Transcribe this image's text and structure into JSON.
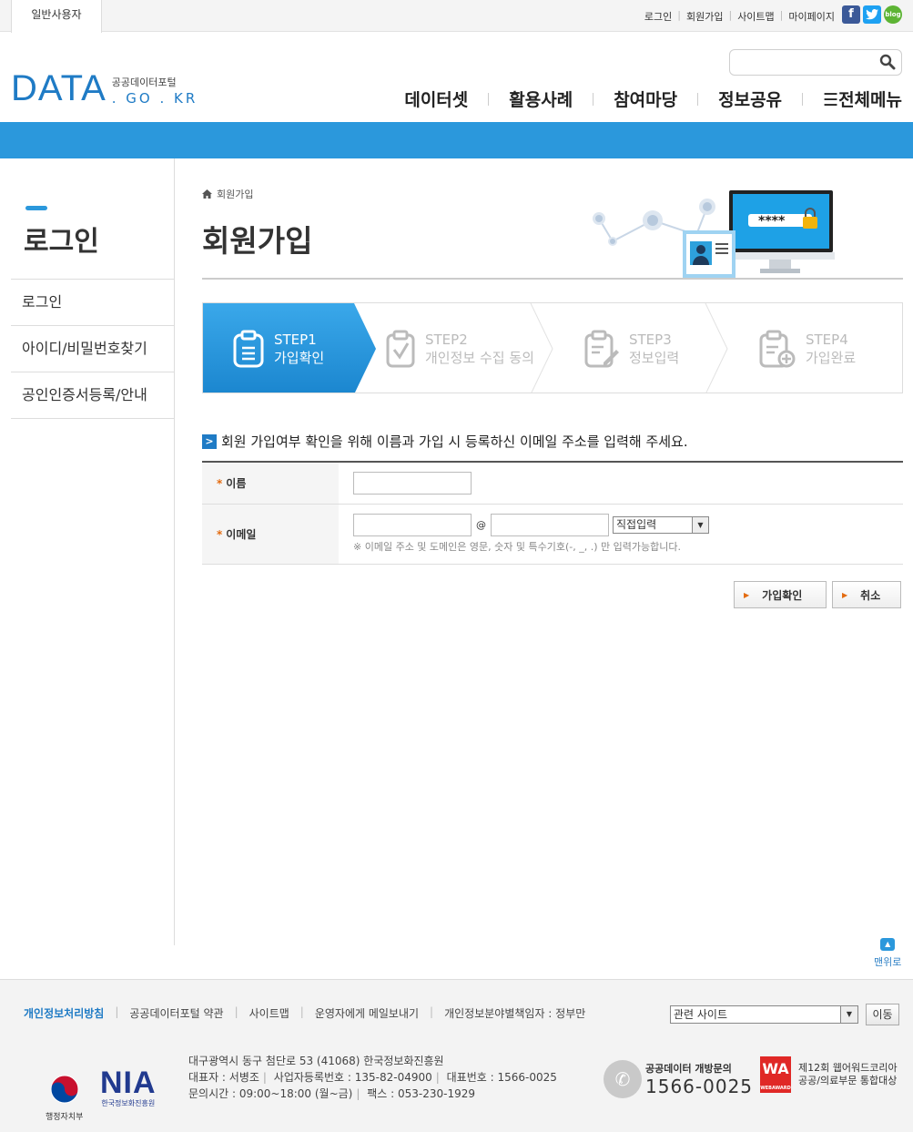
{
  "utility": {
    "user_tab": "일반사용자",
    "links": [
      "로그인",
      "회원가입",
      "사이트맵",
      "마이페이지"
    ],
    "social": {
      "facebook": "f",
      "twitter": "t",
      "blog": "blog"
    }
  },
  "header": {
    "logo_main": "DATA",
    "logo_korean": "공공데이터포털",
    "logo_domain": ". GO . KR",
    "search_placeholder": "",
    "nav": [
      "데이터셋",
      "활용사례",
      "참여마당",
      "정보공유",
      "☰전체메뉴"
    ]
  },
  "sidebar": {
    "title": "로그인",
    "items": [
      "로그인",
      "아이디/비밀번호찾기",
      "공인인증서등록/안내"
    ]
  },
  "content": {
    "breadcrumb": "회원가입",
    "title": "회원가입",
    "illustration_password": "****",
    "steps": [
      {
        "num": "STEP1",
        "label": "가입확인"
      },
      {
        "num": "STEP2",
        "label": "개인정보 수집 동의"
      },
      {
        "num": "STEP3",
        "label": "정보입력"
      },
      {
        "num": "STEP4",
        "label": "가입완료"
      }
    ],
    "notice": "회원 가입여부 확인을 위해 이름과 가입 시 등록하신 이메일 주소를 입력해 주세요.",
    "form": {
      "name_label": "이름",
      "email_label": "이메일",
      "at": "@",
      "domain_select": "직접입력",
      "email_hint": "※ 이메일 주소 및 도메인은 영문, 숫자 및 특수기호(-, _, .) 만 입력가능합니다."
    },
    "buttons": {
      "confirm": "가입확인",
      "cancel": "취소"
    },
    "to_top": "맨위로"
  },
  "footer": {
    "links": [
      "개인정보처리방침",
      "공공데이터포털 약관",
      "사이트맵",
      "운영자에게 메일보내기",
      "개인정보분야별책임자 : 정부만"
    ],
    "related_select": "관련 사이트",
    "go_button": "이동",
    "ministry": "행정자치부",
    "nia": "NIA",
    "nia_sub": "한국정보화진흥원",
    "address_line1": "대구광역시 동구 첨단로 53 (41068) 한국정보화진흥원",
    "rep": "대표자 : 서병조",
    "bizno": "사업자등록번호 : 135-82-04900",
    "tel": "대표번호 : 1566-0025",
    "hours": "문의시간 : 09:00~18:00 (월~금)",
    "fax": "팩스 : 053-230-1929",
    "call_label": "공공데이터 개방문의",
    "call_number": "1566-0025",
    "award_logo": "WA",
    "award_logo_sub": "WEBAWARD",
    "award_line1": "제12회 웹어워드코리아",
    "award_line2": "공공/의료부문 통합대상"
  },
  "colors": {
    "accent": "#2b98dc",
    "brand": "#1f7bc5",
    "star": "#e36b10"
  }
}
